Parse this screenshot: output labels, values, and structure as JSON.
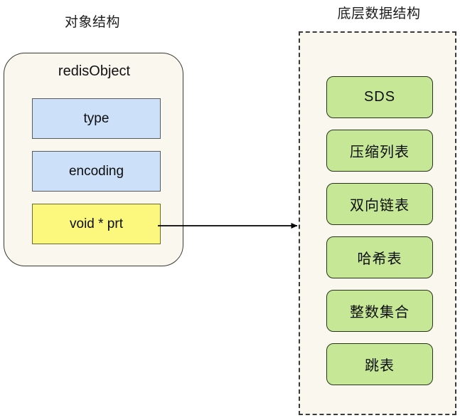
{
  "diagram": {
    "left_panel": {
      "title": "对象结构",
      "card_title": "redisObject",
      "fields": [
        {
          "label": "type",
          "color": "#cce0fa",
          "kind": "blue"
        },
        {
          "label": "encoding",
          "color": "#cce0fa",
          "kind": "blue"
        },
        {
          "label": "void * prt",
          "color": "#fbf87d",
          "kind": "yellow"
        }
      ],
      "card_background": "#faf7ef",
      "card_border": "#3a3a33"
    },
    "connector": {
      "icon": "arrow-right-icon",
      "from": "void * prt",
      "to": "底层数据结构",
      "color": "#000000"
    },
    "right_panel": {
      "title": "底层数据结构",
      "background": "#faf7ef",
      "border": "#3b3b3b",
      "border_style": "dashed",
      "box_color": "#c6e896",
      "box_border": "#28331c",
      "items": [
        {
          "label": "SDS"
        },
        {
          "label": "压缩列表"
        },
        {
          "label": "双向链表"
        },
        {
          "label": "哈希表"
        },
        {
          "label": "整数集合"
        },
        {
          "label": "跳表"
        }
      ]
    }
  }
}
